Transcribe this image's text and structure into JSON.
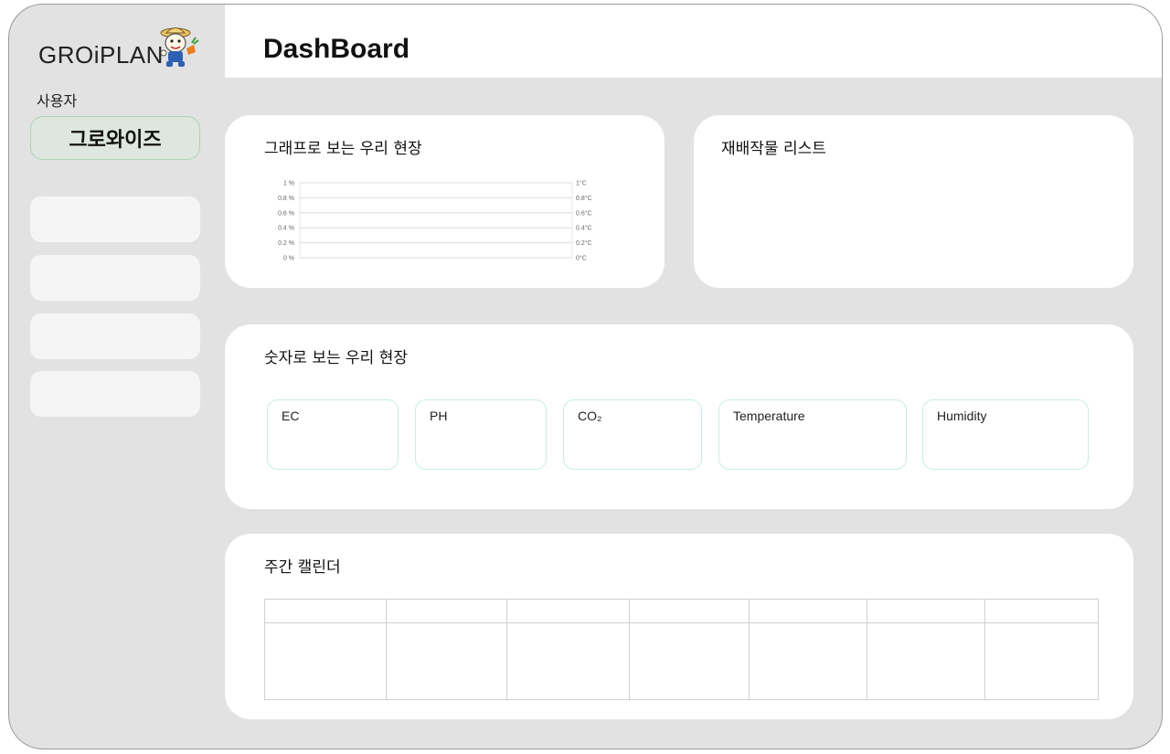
{
  "app": {
    "logo_text": "GROiPLAN",
    "page_title": "DashBoard"
  },
  "sidebar": {
    "user_label": "사용자",
    "user_name": "그로와이즈",
    "nav_items": [
      "",
      "",
      "",
      ""
    ]
  },
  "graph_card": {
    "title": "그래프로 보는 우리 현장"
  },
  "chart_data": {
    "type": "line",
    "series": [],
    "left_ticks": [
      "1 %",
      "0.8 %",
      "0.6 %",
      "0.4 %",
      "0.2 %",
      "0 %"
    ],
    "right_ticks": [
      "1°C",
      "0.8°C",
      "0.6°C",
      "0.4°C",
      "0.2°C",
      "0°C"
    ],
    "ylim_left": [
      0,
      1
    ],
    "ylim_right": [
      0,
      1
    ],
    "grid": true
  },
  "crop_card": {
    "title": "재배작물 리스트"
  },
  "numbers_card": {
    "title": "숫자로 보는 우리 현장",
    "metrics": [
      {
        "label": "EC"
      },
      {
        "label": "PH"
      },
      {
        "label": "CO₂"
      },
      {
        "label": "Temperature"
      },
      {
        "label": "Humidity"
      }
    ]
  },
  "calendar_card": {
    "title": "주간 캘린더",
    "columns": 7
  },
  "colors": {
    "background": "#e2e2e2",
    "card": "#ffffff",
    "user_badge_bg": "#dde6df",
    "user_badge_border": "#a9d4b3",
    "metric_border": "#c8eedd"
  },
  "icons": [
    "groiplan-mascot-icon"
  ]
}
